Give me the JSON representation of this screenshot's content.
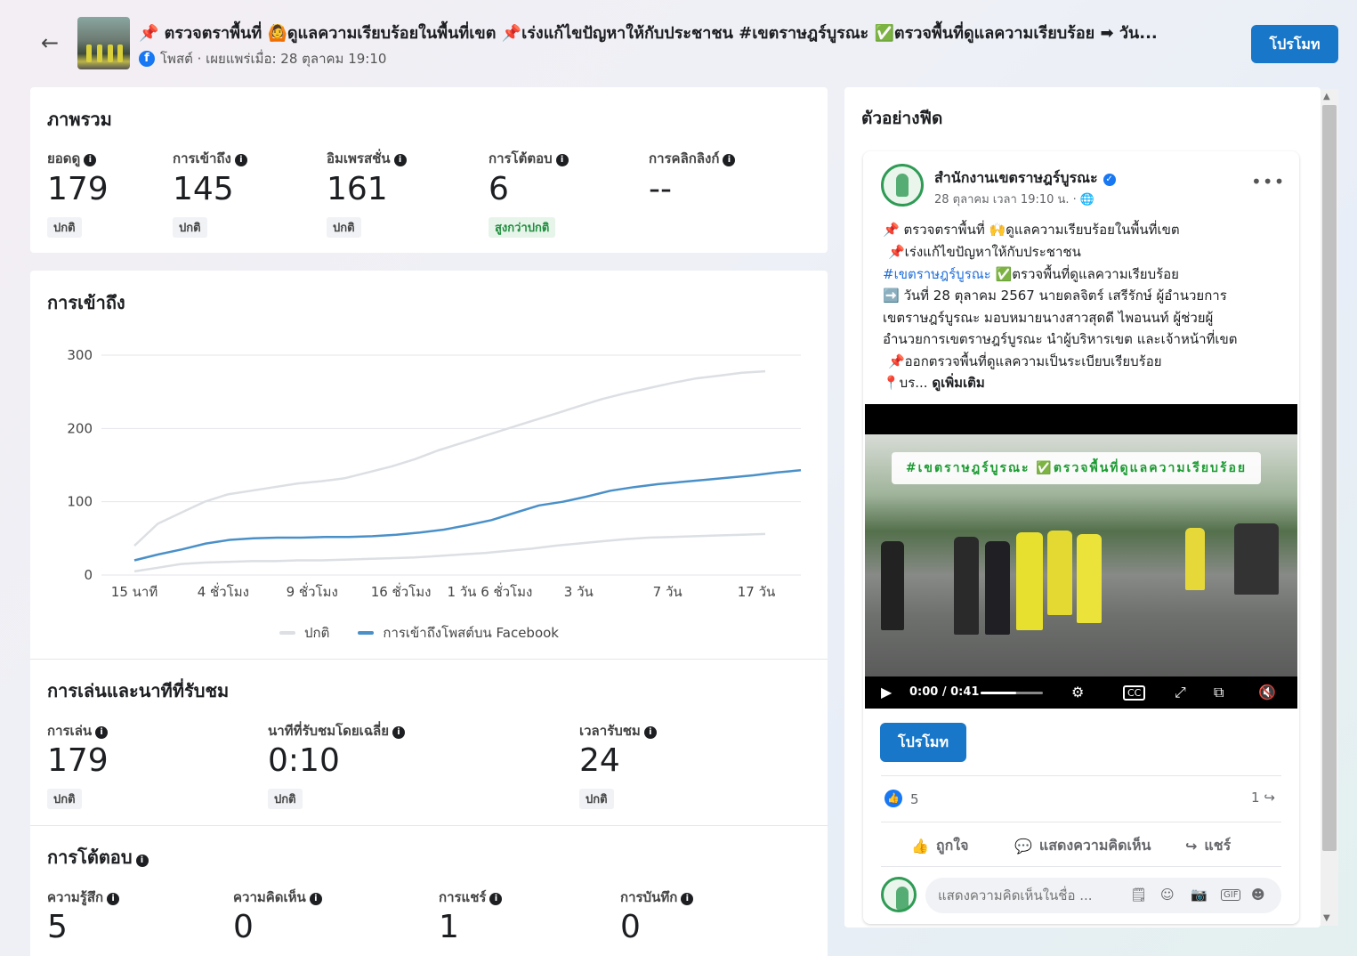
{
  "header": {
    "title": "📌 ตรวจตราพื้นที่ 🙆ดูแลความเรียบร้อยในพื้นที่เขต 📌เร่งแก้ไขปัญหาให้กับประชาชน #เขตราษฎร์บูรณะ ✅ตรวจพื้นที่ดูแลความเรียบร้อย ➡ วัน...",
    "fb_glyph": "f",
    "subtitle": "โพสต์ · เผยแพร่เมื่อ: 28 ตุลาคม 19:10",
    "back_icon": "←",
    "promote_label": "โปรโมท"
  },
  "overview": {
    "title": "ภาพรวม",
    "metrics": [
      {
        "label": "ยอดดู",
        "value": "179",
        "status": "ปกติ"
      },
      {
        "label": "การเข้าถึง",
        "value": "145",
        "status": "ปกติ"
      },
      {
        "label": "อิมเพรสชั่น",
        "value": "161",
        "status": "ปกติ"
      },
      {
        "label": "การโต้ตอบ",
        "value": "6",
        "status": "สูงกว่าปกติ"
      },
      {
        "label": "การคลิกลิงก์",
        "value": "--",
        "status": ""
      }
    ]
  },
  "reach": {
    "title": "การเข้าถึง"
  },
  "chart_data": {
    "type": "line",
    "title": "การเข้าถึง",
    "xlabel": "",
    "ylabel": "",
    "ylim": [
      0,
      300
    ],
    "yticks": [
      "0",
      "100",
      "200",
      "300"
    ],
    "x_tick_labels": [
      "15 นาที",
      "4 ชั่วโมง",
      "9 ชั่วโมง",
      "16 ชั่วโมง",
      "1 วัน 6 ชั่วโมง",
      "3 วัน",
      "7 วัน",
      "17 วัน"
    ],
    "grid": true,
    "legend_position": "bottom",
    "series": [
      {
        "name": "ปกติ",
        "color": "#dcdfe3",
        "values": [
          40,
          70,
          85,
          100,
          110,
          115,
          120,
          125,
          128,
          132,
          140,
          148,
          158,
          170,
          180,
          190,
          200,
          210,
          220,
          230,
          240,
          248,
          255,
          262,
          268,
          272,
          276,
          278
        ]
      },
      {
        "name": "ปกติ",
        "color": "#dcdfe3",
        "values": [
          5,
          10,
          15,
          17,
          18,
          19,
          19,
          20,
          20,
          21,
          22,
          23,
          24,
          26,
          28,
          30,
          33,
          36,
          40,
          43,
          46,
          49,
          51,
          52,
          53,
          54,
          55,
          56
        ]
      },
      {
        "name": "การเข้าถึงโพสต์บน Facebook",
        "color": "#4a90c8",
        "values": [
          20,
          28,
          35,
          43,
          48,
          50,
          51,
          51,
          52,
          52,
          53,
          55,
          58,
          62,
          68,
          75,
          85,
          95,
          100,
          107,
          115,
          120,
          124,
          127,
          130,
          133,
          136,
          140,
          143
        ]
      }
    ]
  },
  "playback": {
    "title": "การเล่นและนาทีที่รับชม",
    "metrics": [
      {
        "label": "การเล่น",
        "value": "179",
        "status": "ปกติ"
      },
      {
        "label": "นาทีที่รับชมโดยเฉลี่ย",
        "value": "0:10",
        "status": "ปกติ"
      },
      {
        "label": "เวลารับชม",
        "value": "24",
        "status": "ปกติ"
      }
    ]
  },
  "interactions": {
    "title": "การโต้ตอบ",
    "metrics": [
      {
        "label": "ความรู้สึก",
        "value": "5"
      },
      {
        "label": "ความคิดเห็น",
        "value": "0"
      },
      {
        "label": "การแชร์",
        "value": "1"
      },
      {
        "label": "การบันทึก",
        "value": "0"
      }
    ]
  },
  "feed_preview": {
    "title": "ตัวอย่างฟีด",
    "page_name": "สำนักงานเขตราษฎร์บูรณะ",
    "verified_mark": "✓",
    "meta": "28 ตุลาคม เวลา 19:10 น. · 🌐",
    "more": "•••",
    "lines": [
      "📌 ตรวจตราพื้นที่ 🙌ดูแลความเรียบร้อยในพื้นที่เขต",
      "📌เร่งแก้ไขปัญหาให้กับประชาชน",
      "➡️ วันที่ 28 ตุลาคม 2567 นายดลจิตร์ เสรีรักษ์ ผู้อำนวยการ",
      "เขตราษฎร์บูรณะ มอบหมายนางสาวสุดดี ไพอนนท์ ผู้ช่วยผู้",
      "อำนวยการเขตราษฎร์บูรณะ นำผู้บริหารเขต และเจ้าหน้าที่เขต",
      "📌ออกตรวจพื้นที่ดูแลความเป็นระเบียบเรียบร้อย",
      "📍บร..."
    ],
    "hashtag": "#เขตราษฎร์บูรณะ",
    "hashtag_rest": " ✅ตรวจพื้นที่ดูแลความเรียบร้อย",
    "see_more": "ดูเพิ่มเติม",
    "video_banner": "#เขตราษฎร์บูรณะ ✅ตรวจพื้นที่ดูแลความเรียบร้อย",
    "video_time": "0:00 / 0:41",
    "video_progress": 0.0,
    "promote_label": "โปรโมท",
    "like_count": "5",
    "share_count": "1",
    "like_glyph": "👍",
    "actions": {
      "like": "ถูกใจ",
      "comment": "แสดงความคิดเห็น",
      "share": "แชร์"
    },
    "comment_placeholder": "แสดงความคิดเห็นในชื่อ ..."
  },
  "colors": {
    "accent": "#1877c9",
    "reach_line": "#4a90c8",
    "baseline_line": "#dcdfe3",
    "above_normal": "#1f8e3d"
  }
}
